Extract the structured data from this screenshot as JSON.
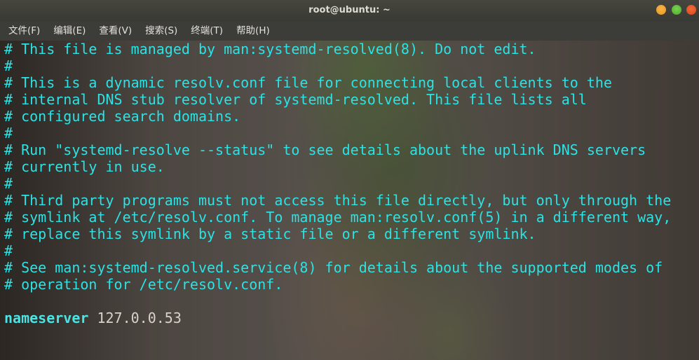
{
  "window": {
    "title": "root@ubuntu: ~"
  },
  "menubar": {
    "items": [
      {
        "label": "文件(F)"
      },
      {
        "label": "编辑(E)"
      },
      {
        "label": "查看(V)"
      },
      {
        "label": "搜索(S)"
      },
      {
        "label": "终端(T)"
      },
      {
        "label": "帮助(H)"
      }
    ]
  },
  "terminal": {
    "lines": [
      "# This file is managed by man:systemd-resolved(8). Do not edit.",
      "#",
      "# This is a dynamic resolv.conf file for connecting local clients to the",
      "# internal DNS stub resolver of systemd-resolved. This file lists all",
      "# configured search domains.",
      "#",
      "# Run \"systemd-resolve --status\" to see details about the uplink DNS servers",
      "# currently in use.",
      "#",
      "# Third party programs must not access this file directly, but only through the",
      "# symlink at /etc/resolv.conf. To manage man:resolv.conf(5) in a different way,",
      "# replace this symlink by a static file or a different symlink.",
      "#",
      "# See man:systemd-resolved.service(8) for details about the supported modes of",
      "# operation for /etc/resolv.conf."
    ],
    "nameserver": {
      "keyword": "nameserver",
      "value": "127.0.0.53"
    }
  },
  "colors": {
    "comment": "#2ee1e3",
    "keyword": "#4be3e3",
    "value": "#d7d3cc",
    "titlebar": "#3a3a35"
  }
}
